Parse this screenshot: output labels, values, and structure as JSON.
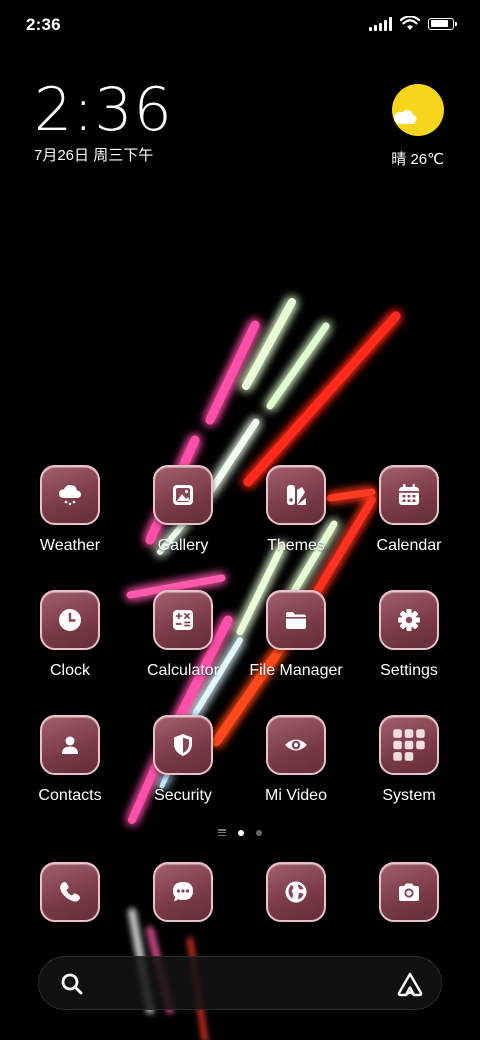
{
  "status_bar": {
    "time": "2:36",
    "battery_percent": 90
  },
  "clock_widget": {
    "time": "2:36",
    "date": "7月26日 周三下午"
  },
  "weather_widget": {
    "condition": "晴",
    "temperature": "26℃",
    "icon": "sunny-partly-cloudy-icon"
  },
  "apps": [
    {
      "label": "Weather",
      "icon": "cloud-snow-icon"
    },
    {
      "label": "Gallery",
      "icon": "image-icon"
    },
    {
      "label": "Themes",
      "icon": "themes-icon"
    },
    {
      "label": "Calendar",
      "icon": "calendar-icon"
    },
    {
      "label": "Clock",
      "icon": "clock-icon"
    },
    {
      "label": "Calculator",
      "icon": "calculator-icon"
    },
    {
      "label": "File Manager",
      "icon": "folder-icon"
    },
    {
      "label": "Settings",
      "icon": "gear-icon"
    },
    {
      "label": "Contacts",
      "icon": "person-icon"
    },
    {
      "label": "Security",
      "icon": "shield-icon"
    },
    {
      "label": "Mi Video",
      "icon": "eye-icon"
    },
    {
      "label": "System",
      "icon": "folder-grid-icon"
    }
  ],
  "dock": [
    {
      "icon": "phone-icon"
    },
    {
      "icon": "message-icon"
    },
    {
      "icon": "globe-icon"
    },
    {
      "icon": "camera-icon"
    }
  ],
  "pages": {
    "count": 2,
    "current": 1
  },
  "search_bar": {
    "left_icon": "search-icon",
    "right_icon": "assistant-icon"
  },
  "colors": {
    "icon_bg": "#7c3c49",
    "icon_border": "#e9c2c9",
    "sun": "#f7d51d"
  }
}
